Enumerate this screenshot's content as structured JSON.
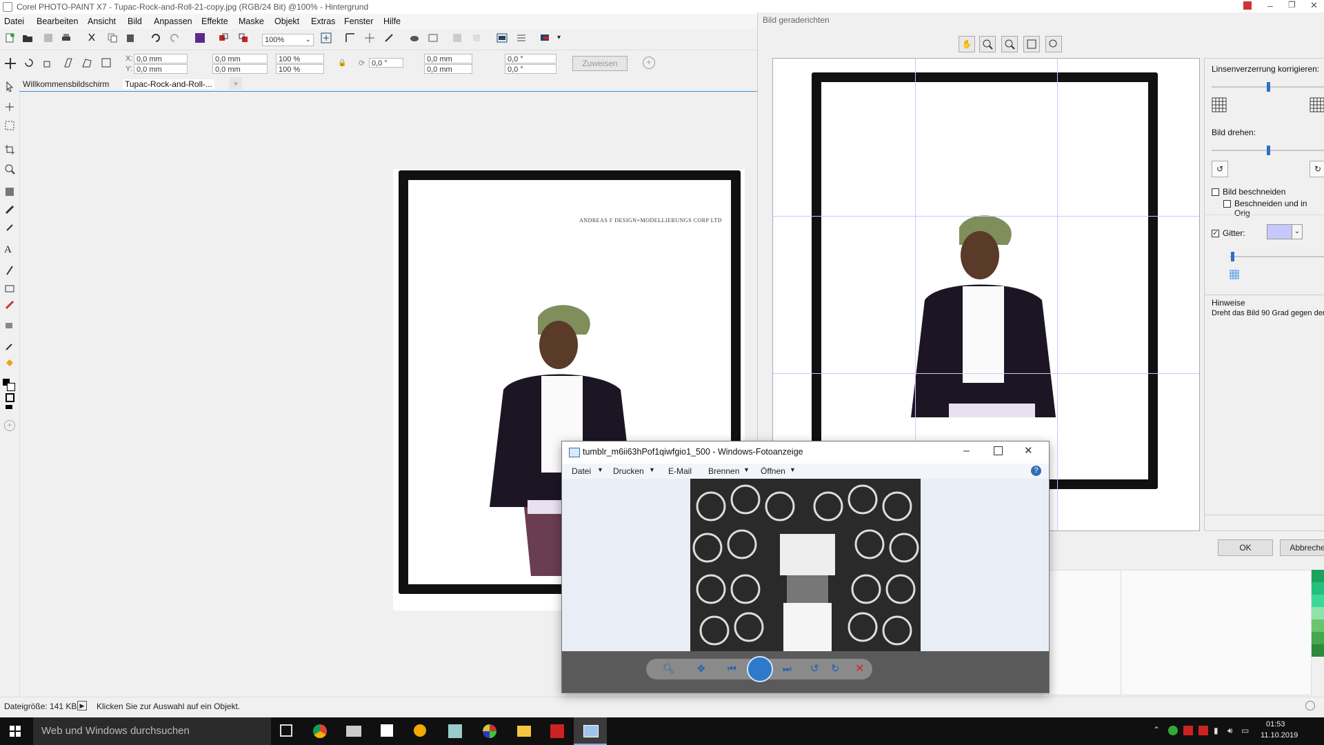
{
  "corel": {
    "title": "Corel PHOTO-PAINT X7 - Tupac-Rock-and-Roll-21-copy.jpg (RGB/24 Bit) @100% - Hintergrund",
    "menu": [
      "Datei",
      "Bearbeiten",
      "Ansicht",
      "Bild",
      "Anpassen",
      "Effekte",
      "Maske",
      "Objekt",
      "Extras",
      "Fenster",
      "Hilfe"
    ],
    "zoom": "100%",
    "props": {
      "x_label": "X:",
      "x_value": "0,0 mm",
      "y_label": "Y:",
      "y_value": "0,0 mm",
      "w_value": "0,0 mm",
      "h_value": "0,0 mm",
      "scale_x": "100 %",
      "scale_y": "100 %",
      "angle": "0,0 °",
      "center_x": "0,0 mm",
      "center_y": "0,0 mm",
      "skew_h": "0,0 °",
      "skew_v": "0,0 °",
      "apply_button": "Zuweisen"
    },
    "tabs": [
      "Willkommensbildschirm",
      "Tupac-Rock-and-Roll-..."
    ],
    "photo_caption": "ANDREAS F DESIGN+MODELLIERUNGS CORP LTD",
    "status": {
      "filesize": "Dateigröße: 141 KB",
      "hint": "Klicken Sie zur Auswahl auf ein Objekt."
    }
  },
  "dialog": {
    "title": "Bild geraderichten",
    "lens_label": "Linsenverzerrung korrigieren:",
    "lens_value": 0.5,
    "rotate_label": "Bild drehen:",
    "rotate_value": 0.5,
    "crop_label": "Bild beschneiden",
    "crop_checked": false,
    "crop_orig_label": "Beschneiden und in Orig",
    "crop_orig_checked": false,
    "grid_label": "Gitter:",
    "grid_checked": true,
    "grid_color": "#c8c8ff",
    "hints_title": "Hinweise",
    "hints_text": "Dreht das Bild 90 Grad gegen den",
    "ok": "OK",
    "cancel": "Abbreche"
  },
  "viewer": {
    "title": "tumblr_m6ii63hPof1qiwfgio1_500 - Windows-Fotoanzeige",
    "menu": [
      "Datei",
      "Drucken",
      "E-Mail",
      "Brennen",
      "Öffnen"
    ]
  },
  "taskbar": {
    "search_placeholder": "Web und Windows durchsuchen",
    "time": "01:53",
    "date": "11.10.2019"
  }
}
